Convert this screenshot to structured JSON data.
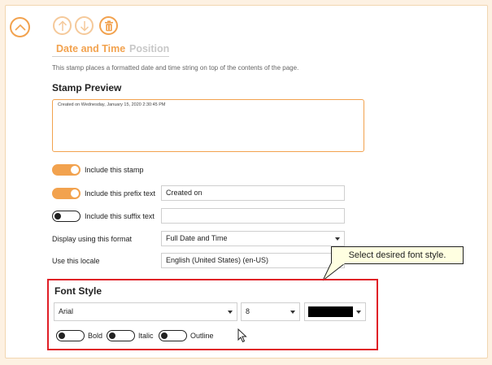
{
  "tabs": [
    {
      "label": "Date and Time",
      "active": true
    },
    {
      "label": "Position",
      "active": false
    }
  ],
  "description": "This stamp places a formatted date and time string on top of the contents of the page.",
  "preview": {
    "heading": "Stamp Preview",
    "text": "Created on Wednesday, January 15, 2020 2:30:45 PM"
  },
  "options": {
    "include_stamp": {
      "label": "Include this stamp",
      "on": true
    },
    "include_prefix": {
      "label": "Include this prefix text",
      "on": true,
      "value": "Created on"
    },
    "include_suffix": {
      "label": "Include this suffix text",
      "on": false,
      "value": ""
    },
    "format": {
      "label": "Display using this format",
      "value": "Full Date and Time"
    },
    "locale": {
      "label": "Use this locale",
      "value": "English (United States) (en-US)"
    }
  },
  "tooltip": "Select desired font style.",
  "font_style": {
    "heading": "Font Style",
    "font": "Arial",
    "size": "8",
    "color": "#000000",
    "bold_label": "Bold",
    "italic_label": "Italic",
    "outline_label": "Outline"
  },
  "colors": {
    "accent": "#f2a24e",
    "highlight": "#e01e26"
  }
}
